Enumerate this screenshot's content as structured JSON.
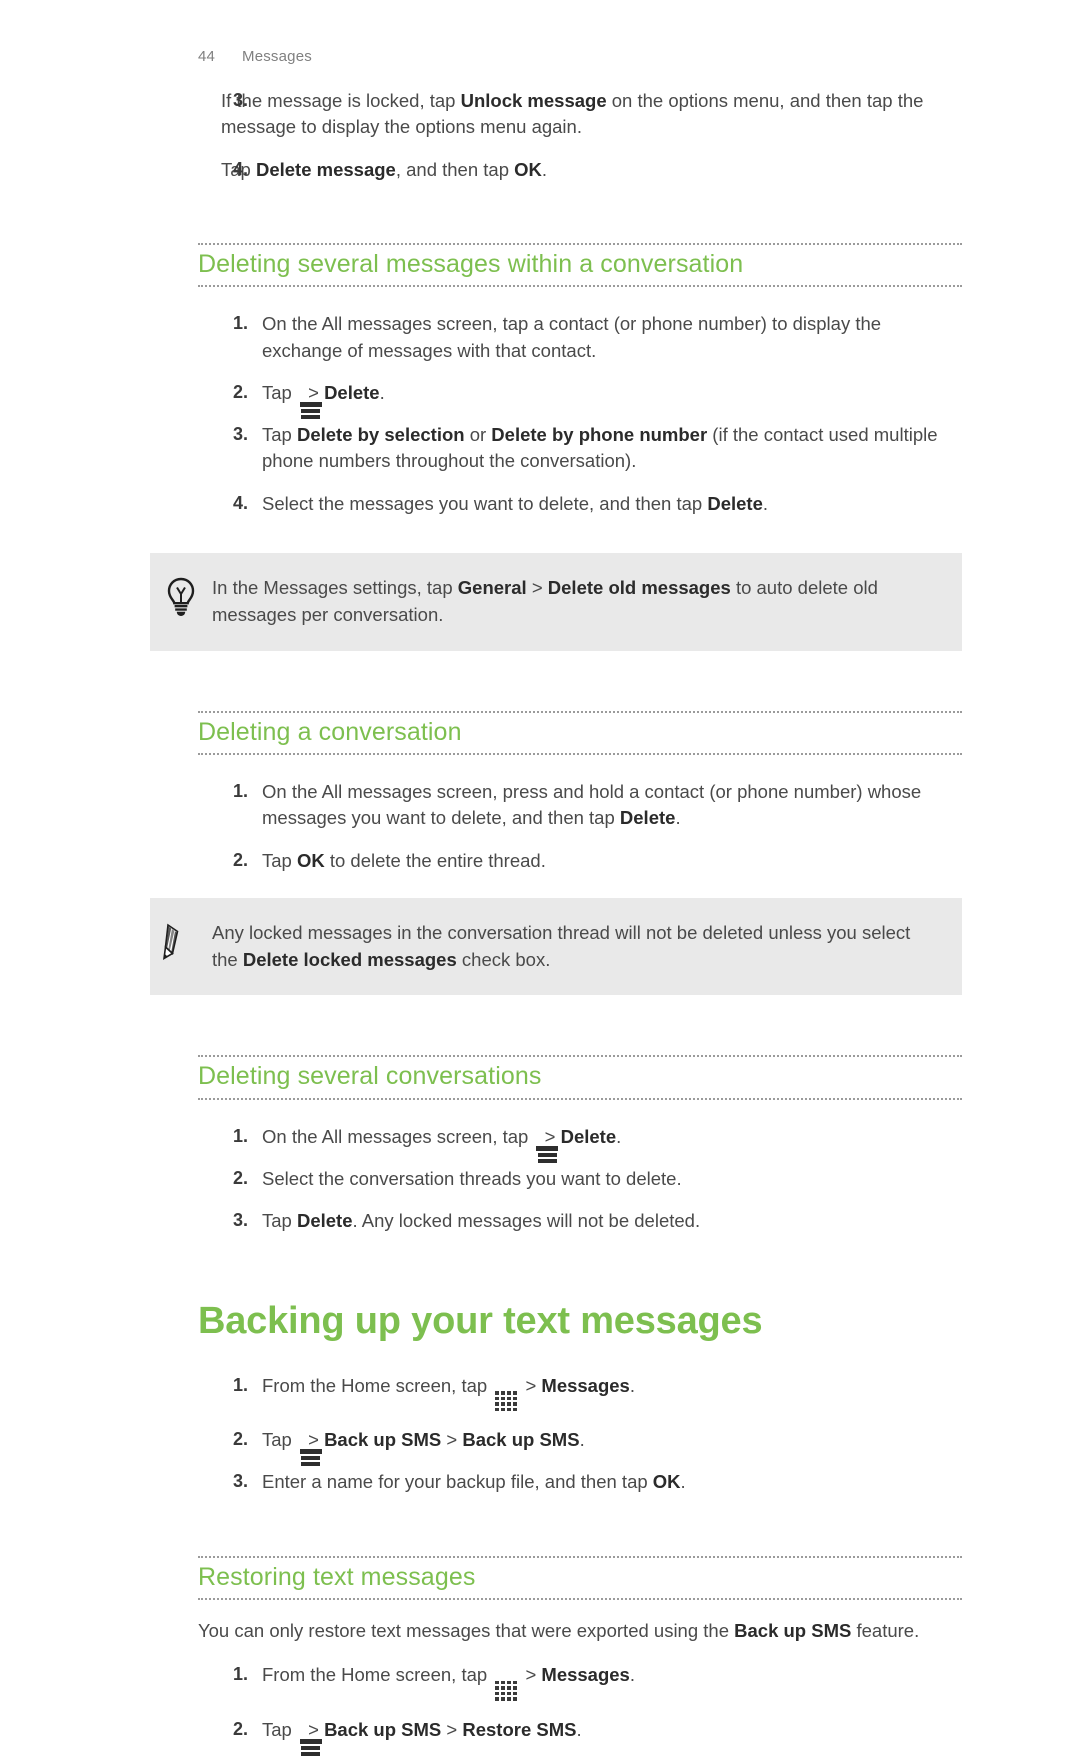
{
  "document": {
    "page_number": "44",
    "chapter": "Messages",
    "accent_color": "#7dbf4f",
    "text_color": "#4a4a4a",
    "callout_bg": "#e9e9e9"
  },
  "continued_steps": [
    {
      "num": "3.",
      "parts": [
        {
          "t": "If the message is locked, tap ",
          "b": false
        },
        {
          "t": "Unlock message",
          "b": true
        },
        {
          "t": " on the options menu, and then tap the message to display the options menu again.",
          "b": false
        }
      ]
    },
    {
      "num": "4.",
      "parts": [
        {
          "t": "Tap ",
          "b": false
        },
        {
          "t": "Delete message",
          "b": true
        },
        {
          "t": ", and then tap ",
          "b": false
        },
        {
          "t": "OK",
          "b": true
        },
        {
          "t": ".",
          "b": false
        }
      ]
    }
  ],
  "sections": [
    {
      "id": "deleting-several-messages",
      "heading": "Deleting several messages within a conversation",
      "steps": [
        {
          "num": "1.",
          "parts": [
            {
              "t": "On the All messages screen, tap a contact (or phone number) to display the exchange of messages with that contact.",
              "b": false
            }
          ]
        },
        {
          "num": "2.",
          "parts": [
            {
              "t": "Tap ",
              "b": false
            },
            {
              "icon": "menu-icon"
            },
            {
              "t": " > ",
              "b": false
            },
            {
              "t": "Delete",
              "b": true
            },
            {
              "t": ".",
              "b": false
            }
          ]
        },
        {
          "num": "3.",
          "parts": [
            {
              "t": "Tap ",
              "b": false
            },
            {
              "t": "Delete by selection",
              "b": true
            },
            {
              "t": " or ",
              "b": false
            },
            {
              "t": "Delete by phone number",
              "b": true
            },
            {
              "t": " (if the contact used multiple phone numbers throughout the conversation).",
              "b": false
            }
          ]
        },
        {
          "num": "4.",
          "parts": [
            {
              "t": "Select the messages you want to delete, and then tap ",
              "b": false
            },
            {
              "t": "Delete",
              "b": true
            },
            {
              "t": ".",
              "b": false
            }
          ]
        }
      ]
    },
    {
      "id": "deleting-a-conversation",
      "heading": "Deleting a conversation",
      "steps": [
        {
          "num": "1.",
          "parts": [
            {
              "t": "On the All messages screen, press and hold a contact (or phone number) whose messages you want to delete, and then tap ",
              "b": false
            },
            {
              "t": "Delete",
              "b": true
            },
            {
              "t": ".",
              "b": false
            }
          ]
        },
        {
          "num": "2.",
          "parts": [
            {
              "t": "Tap ",
              "b": false
            },
            {
              "t": "OK",
              "b": true
            },
            {
              "t": " to delete the entire thread.",
              "b": false
            }
          ]
        }
      ]
    },
    {
      "id": "deleting-several-conversations",
      "heading": "Deleting several conversations",
      "steps": [
        {
          "num": "1.",
          "parts": [
            {
              "t": "On the All messages screen, tap ",
              "b": false
            },
            {
              "icon": "menu-icon"
            },
            {
              "t": " > ",
              "b": false
            },
            {
              "t": "Delete",
              "b": true
            },
            {
              "t": ".",
              "b": false
            }
          ]
        },
        {
          "num": "2.",
          "parts": [
            {
              "t": "Select the conversation threads you want to delete.",
              "b": false
            }
          ]
        },
        {
          "num": "3.",
          "parts": [
            {
              "t": "Tap ",
              "b": false
            },
            {
              "t": "Delete",
              "b": true
            },
            {
              "t": ". Any locked messages will not be deleted.",
              "b": false
            }
          ]
        }
      ]
    }
  ],
  "chapter_title": "Backing up your text messages",
  "backup_steps": [
    {
      "num": "1.",
      "parts": [
        {
          "t": "From the Home screen, tap ",
          "b": false
        },
        {
          "icon": "app-grid-icon"
        },
        {
          "t": " > ",
          "b": false
        },
        {
          "t": "Messages",
          "b": true
        },
        {
          "t": ".",
          "b": false
        }
      ]
    },
    {
      "num": "2.",
      "parts": [
        {
          "t": "Tap ",
          "b": false
        },
        {
          "icon": "menu-icon"
        },
        {
          "t": " > ",
          "b": false
        },
        {
          "t": "Back up SMS",
          "b": true
        },
        {
          "t": " > ",
          "b": false
        },
        {
          "t": "Back up SMS",
          "b": true
        },
        {
          "t": ".",
          "b": false
        }
      ]
    },
    {
      "num": "3.",
      "parts": [
        {
          "t": "Enter a name for your backup file, and then tap ",
          "b": false
        },
        {
          "t": "OK",
          "b": true
        },
        {
          "t": ".",
          "b": false
        }
      ]
    }
  ],
  "restoring": {
    "heading": "Restoring text messages",
    "intro_parts": [
      {
        "t": "You can only restore text messages that were exported using the ",
        "b": false
      },
      {
        "t": "Back up SMS",
        "b": true
      },
      {
        "t": " feature.",
        "b": false
      }
    ],
    "steps": [
      {
        "num": "1.",
        "parts": [
          {
            "t": "From the Home screen, tap ",
            "b": false
          },
          {
            "icon": "app-grid-icon"
          },
          {
            "t": " > ",
            "b": false
          },
          {
            "t": "Messages",
            "b": true
          },
          {
            "t": ".",
            "b": false
          }
        ]
      },
      {
        "num": "2.",
        "parts": [
          {
            "t": "Tap ",
            "b": false
          },
          {
            "icon": "menu-icon"
          },
          {
            "t": " > ",
            "b": false
          },
          {
            "t": "Back up SMS",
            "b": true
          },
          {
            "t": " > ",
            "b": false
          },
          {
            "t": "Restore SMS",
            "b": true
          },
          {
            "t": ".",
            "b": false
          }
        ]
      }
    ]
  },
  "callouts": [
    {
      "id": "tip-delete-old-messages",
      "icon": "lightbulb-icon",
      "parts": [
        {
          "t": "In the Messages settings, tap ",
          "b": false
        },
        {
          "t": "General",
          "b": true
        },
        {
          "t": " > ",
          "b": false
        },
        {
          "t": "Delete old messages",
          "b": true
        },
        {
          "t": " to auto delete old messages per conversation.",
          "b": false
        }
      ]
    },
    {
      "id": "note-locked-messages",
      "icon": "pencil-icon",
      "parts": [
        {
          "t": "Any locked messages in the conversation thread will not be deleted unless you select the ",
          "b": false
        },
        {
          "t": "Delete locked messages",
          "b": true
        },
        {
          "t": " check box.",
          "b": false
        }
      ]
    }
  ]
}
